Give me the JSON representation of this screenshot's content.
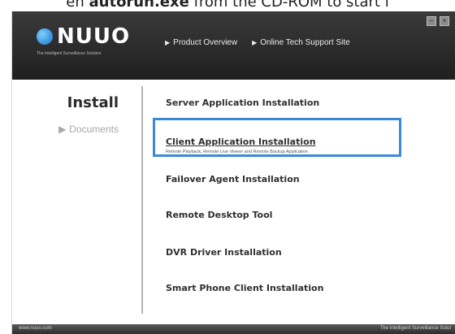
{
  "caption": {
    "prefix": "en ",
    "bold": "autorun.exe",
    "suffix": " from the CD-ROM to start i"
  },
  "window": {
    "controls": [
      "–",
      "×"
    ]
  },
  "header": {
    "logo_text": "NUUO",
    "tagline": "The Intelligent Surveillance Solution",
    "nav": [
      {
        "label": "Product Overview",
        "icon": "play-arrow-icon"
      },
      {
        "label": "Online Tech Support Site",
        "icon": "play-arrow-icon"
      }
    ]
  },
  "left_menu": {
    "title": "Install",
    "documents_label": "Documents",
    "documents_icon": "play-arrow-icon"
  },
  "content": {
    "items": [
      {
        "label": "Server Application Installation"
      },
      {
        "label": "Client Application Installation",
        "description": "Remote Playback, Remote Live Viewer and Remote Backup Application"
      },
      {
        "label": "Failover Agent Installation"
      },
      {
        "label": "Remote Desktop Tool"
      },
      {
        "label": "DVR Driver Installation"
      },
      {
        "label": "Smart Phone Client Installation"
      }
    ],
    "selected_index": 1
  },
  "footer": {
    "left": "www.nuuo.com",
    "right": "The Intelligent Surveillance Solut"
  },
  "colors": {
    "highlight_border": "#3c8ad6",
    "header_bg": "#2b2b2b"
  }
}
